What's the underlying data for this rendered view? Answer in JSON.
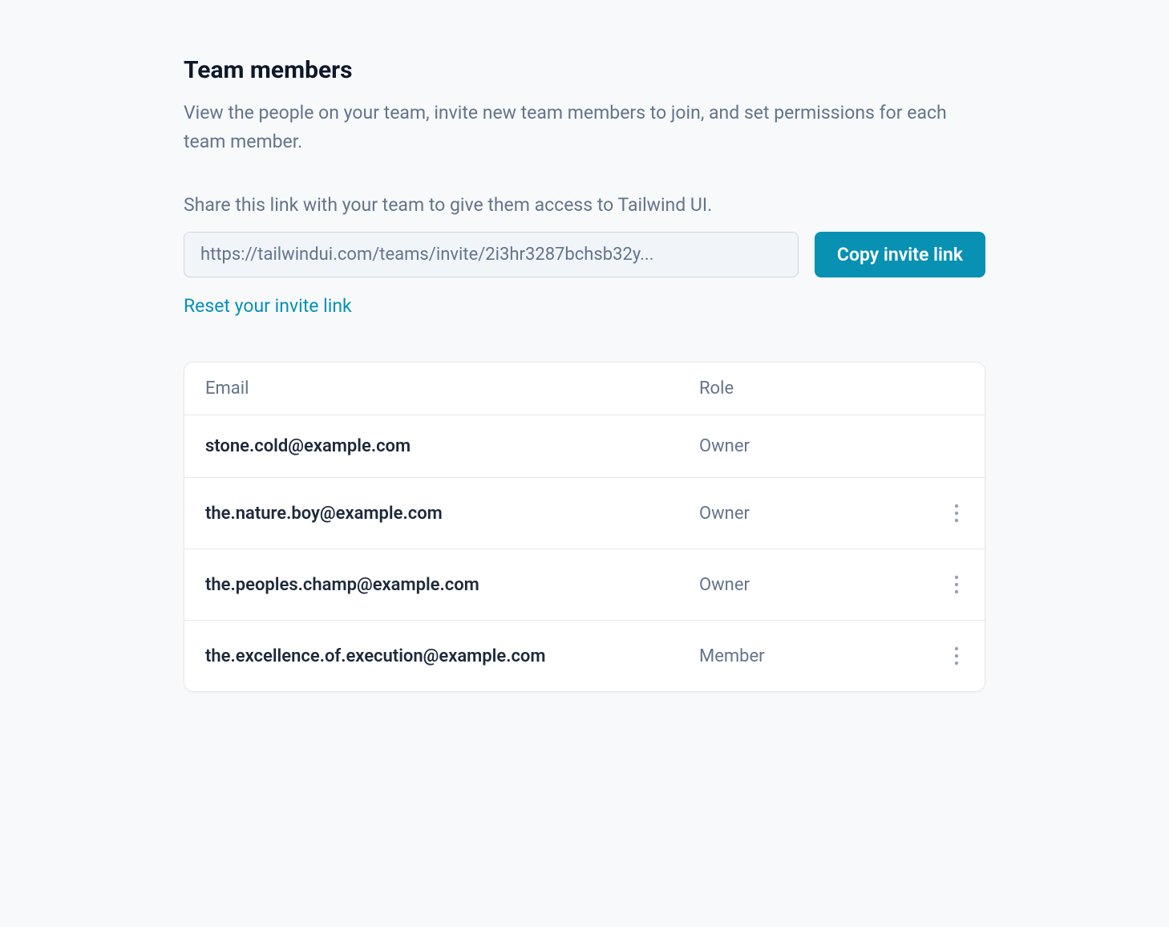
{
  "page": {
    "title": "Team members",
    "description": "View the people on your team, invite new team members to join, and set permissions for each team member.",
    "share_label": "Share this link with your team to give them access to Tailwind UI.",
    "invite_url": "https://tailwindui.com/teams/invite/2i3hr3287bchsb32y...",
    "copy_button": "Copy invite link",
    "reset_link": "Reset your invite link"
  },
  "table": {
    "headers": {
      "email": "Email",
      "role": "Role"
    },
    "rows": [
      {
        "email": "stone.cold@example.com",
        "role": "Owner",
        "has_actions": false
      },
      {
        "email": "the.nature.boy@example.com",
        "role": "Owner",
        "has_actions": true
      },
      {
        "email": "the.peoples.champ@example.com",
        "role": "Owner",
        "has_actions": true
      },
      {
        "email": "the.excellence.of.execution@example.com",
        "role": "Member",
        "has_actions": true
      }
    ]
  }
}
